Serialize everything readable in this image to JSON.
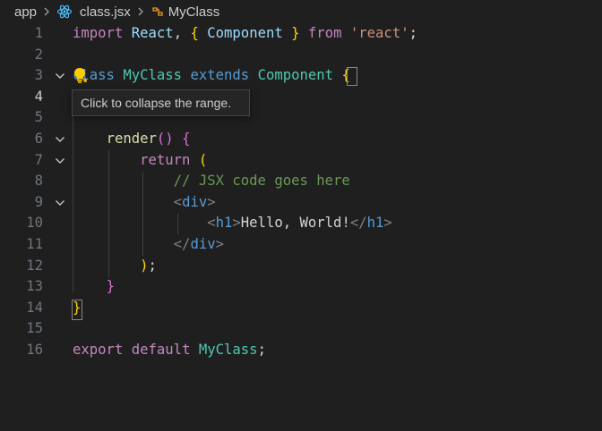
{
  "breadcrumb": {
    "folder": "app",
    "file": "class.jsx",
    "symbol": "MyClass"
  },
  "editor": {
    "lines": [
      {
        "number": "1",
        "tokens": [
          {
            "text": "import",
            "cls": "kw2"
          },
          {
            "text": " ",
            "cls": "plain"
          },
          {
            "text": "React",
            "cls": "var"
          },
          {
            "text": ", ",
            "cls": "plain"
          },
          {
            "text": "{",
            "cls": "br1"
          },
          {
            "text": " ",
            "cls": "plain"
          },
          {
            "text": "Component",
            "cls": "var"
          },
          {
            "text": " ",
            "cls": "plain"
          },
          {
            "text": "}",
            "cls": "br1"
          },
          {
            "text": " ",
            "cls": "plain"
          },
          {
            "text": "from",
            "cls": "kw2"
          },
          {
            "text": " ",
            "cls": "plain"
          },
          {
            "text": "'react'",
            "cls": "str"
          },
          {
            "text": ";",
            "cls": "plain"
          }
        ]
      },
      {
        "number": "2",
        "tokens": []
      },
      {
        "number": "3",
        "fold": true,
        "tokens": [
          {
            "text": "class",
            "cls": "kw"
          },
          {
            "text": " ",
            "cls": "plain"
          },
          {
            "text": "MyClass",
            "cls": "ty"
          },
          {
            "text": " ",
            "cls": "plain"
          },
          {
            "text": "extends",
            "cls": "kw"
          },
          {
            "text": " ",
            "cls": "plain"
          },
          {
            "text": "Component",
            "cls": "ty"
          },
          {
            "text": " ",
            "cls": "plain"
          },
          {
            "text": "{",
            "cls": "br1"
          }
        ]
      },
      {
        "number": "4",
        "active": true,
        "tokens": []
      },
      {
        "number": "5",
        "tokens": []
      },
      {
        "number": "6",
        "fold": true,
        "tokens": [
          {
            "text": "    ",
            "cls": "plain"
          },
          {
            "text": "render",
            "cls": "fn"
          },
          {
            "text": "()",
            "cls": "br2"
          },
          {
            "text": " ",
            "cls": "plain"
          },
          {
            "text": "{",
            "cls": "br2"
          }
        ]
      },
      {
        "number": "7",
        "fold": true,
        "tokens": [
          {
            "text": "        ",
            "cls": "plain"
          },
          {
            "text": "return",
            "cls": "kw2"
          },
          {
            "text": " ",
            "cls": "plain"
          },
          {
            "text": "(",
            "cls": "br1"
          }
        ]
      },
      {
        "number": "8",
        "tokens": [
          {
            "text": "            ",
            "cls": "plain"
          },
          {
            "text": "// JSX code goes here",
            "cls": "cm"
          }
        ]
      },
      {
        "number": "9",
        "fold": true,
        "tokens": [
          {
            "text": "            ",
            "cls": "plain"
          },
          {
            "text": "<",
            "cls": "tagp"
          },
          {
            "text": "div",
            "cls": "tag"
          },
          {
            "text": ">",
            "cls": "tagp"
          }
        ]
      },
      {
        "number": "10",
        "tokens": [
          {
            "text": "                ",
            "cls": "plain"
          },
          {
            "text": "<",
            "cls": "tagp"
          },
          {
            "text": "h1",
            "cls": "tag"
          },
          {
            "text": ">",
            "cls": "tagp"
          },
          {
            "text": "Hello, World!",
            "cls": "plain"
          },
          {
            "text": "</",
            "cls": "tagp"
          },
          {
            "text": "h1",
            "cls": "tag"
          },
          {
            "text": ">",
            "cls": "tagp"
          }
        ]
      },
      {
        "number": "11",
        "tokens": [
          {
            "text": "            ",
            "cls": "plain"
          },
          {
            "text": "</",
            "cls": "tagp"
          },
          {
            "text": "div",
            "cls": "tag"
          },
          {
            "text": ">",
            "cls": "tagp"
          }
        ]
      },
      {
        "number": "12",
        "tokens": [
          {
            "text": "        ",
            "cls": "plain"
          },
          {
            "text": ")",
            "cls": "br1"
          },
          {
            "text": ";",
            "cls": "plain"
          }
        ]
      },
      {
        "number": "13",
        "tokens": [
          {
            "text": "    ",
            "cls": "plain"
          },
          {
            "text": "}",
            "cls": "br2"
          }
        ]
      },
      {
        "number": "14",
        "tokens": [
          {
            "text": "}",
            "cls": "br1"
          }
        ]
      },
      {
        "number": "15",
        "tokens": []
      },
      {
        "number": "16",
        "tokens": [
          {
            "text": "export",
            "cls": "kw2"
          },
          {
            "text": " ",
            "cls": "plain"
          },
          {
            "text": "default",
            "cls": "kw2"
          },
          {
            "text": " ",
            "cls": "plain"
          },
          {
            "text": "MyClass",
            "cls": "ty"
          },
          {
            "text": ";",
            "cls": "plain"
          }
        ]
      }
    ]
  },
  "tooltip": {
    "text": "Click to collapse the range."
  },
  "colors": {
    "background": "#1f1f1f",
    "keyword": "#569cd6",
    "control_keyword": "#c586c0",
    "type": "#4ec9b0",
    "string": "#ce9178",
    "function": "#dcdcaa",
    "variable": "#9cdcfe",
    "comment": "#6a9955",
    "bracket_gold": "#ffd700",
    "bracket_orchid": "#da70d6",
    "react_blue": "#4fc1ff"
  },
  "icons": {
    "react": "react-icon",
    "class_symbol": "class-symbol-icon",
    "fold": "chevron-down-icon",
    "lightbulb": "lightbulb-icon"
  }
}
